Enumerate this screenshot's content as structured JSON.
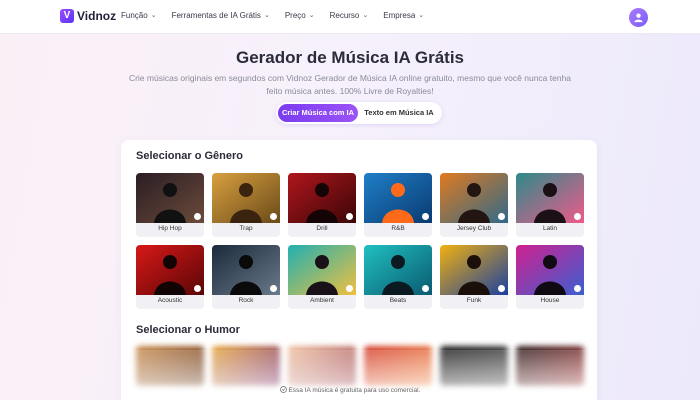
{
  "header": {
    "brand": "Vidnoz",
    "nav": [
      {
        "label": "Função"
      },
      {
        "label": "Ferramentas de IA Grátis"
      },
      {
        "label": "Preço"
      },
      {
        "label": "Recurso"
      },
      {
        "label": "Empresa"
      }
    ]
  },
  "hero": {
    "title": "Gerador de Música IA Grátis",
    "subtitle": "Crie músicas originais em segundos com Vidnoz Gerador de Música IA online gratuito, mesmo que você nunca tenha feito música antes. 100% Livre de Royalties!",
    "tabs": [
      "Criar Música com IA",
      "Texto em Música IA"
    ],
    "active_tab": "Criar Música com IA"
  },
  "genre_section": {
    "title": "Selecionar o Gênero",
    "genres": [
      "Hip Hop",
      "Trap",
      "Drill",
      "R&B",
      "Jersey Club",
      "Latin",
      "Acoustic",
      "Rock",
      "Ambient",
      "Beats",
      "Funk",
      "House"
    ]
  },
  "mood_section": {
    "title": "Selecionar o Humor"
  },
  "footnote": "Essa IA música é gratuita para uso comercial."
}
